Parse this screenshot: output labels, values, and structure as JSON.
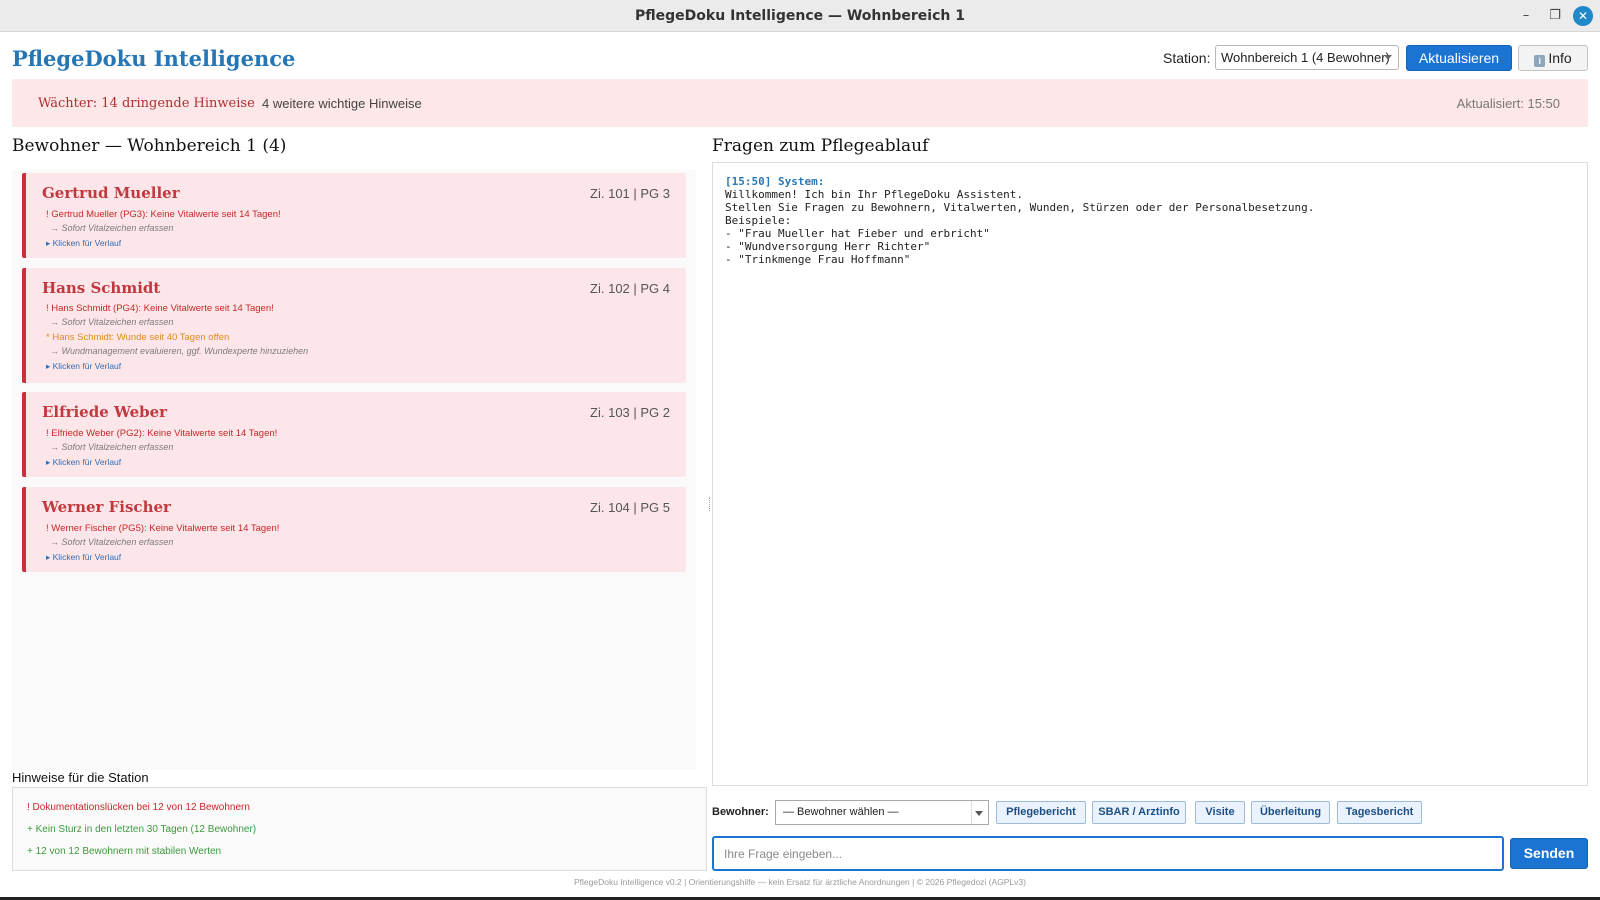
{
  "window": {
    "title": "PflegeDoku Intelligence — Wohnbereich 1",
    "minimize": "–",
    "maximize": "❐",
    "close": "✕"
  },
  "header": {
    "logo": "PflegeDoku Intelligence",
    "station_label": "Station:",
    "station_value": "Wohnbereich 1 (4 Bewohner)",
    "refresh_label": "Aktualisieren",
    "info_label": "Info",
    "info_glyph": "i"
  },
  "alerts": {
    "urgent": "Wächter: 14 dringende Hinweise",
    "more": "4 weitere wichtige Hinweise",
    "updated": "Aktualisiert: 15:50"
  },
  "residents": {
    "title": "Bewohner — Wohnbereich 1 (4)",
    "cards": [
      {
        "name": "Gertrud Mueller",
        "room": "Zi. 101 | PG 3",
        "lines": [
          {
            "type": "crit",
            "text": "! Gertrud Mueller (PG3): Keine Vitalwerte seit 14 Tagen!"
          },
          {
            "type": "hint",
            "text": "→ Sofort Vitalzeichen erfassen"
          },
          {
            "type": "link",
            "text": "▸ Klicken für Verlauf"
          }
        ]
      },
      {
        "name": "Hans Schmidt",
        "room": "Zi. 102 | PG 4",
        "lines": [
          {
            "type": "crit",
            "text": "! Hans Schmidt (PG4): Keine Vitalwerte seit 14 Tagen!"
          },
          {
            "type": "hint",
            "text": "→ Sofort Vitalzeichen erfassen"
          },
          {
            "type": "warn",
            "text": "* Hans Schmidt: Wunde seit 40 Tagen offen"
          },
          {
            "type": "hint",
            "text": "→ Wundmanagement evaluieren, ggf. Wundexperte hinzuziehen"
          },
          {
            "type": "link",
            "text": "▸ Klicken für Verlauf"
          }
        ]
      },
      {
        "name": "Elfriede Weber",
        "room": "Zi. 103 | PG 2",
        "lines": [
          {
            "type": "crit",
            "text": "! Elfriede Weber (PG2): Keine Vitalwerte seit 14 Tagen!"
          },
          {
            "type": "hint",
            "text": "→ Sofort Vitalzeichen erfassen"
          },
          {
            "type": "link",
            "text": "▸ Klicken für Verlauf"
          }
        ]
      },
      {
        "name": "Werner Fischer",
        "room": "Zi. 104 | PG 5",
        "lines": [
          {
            "type": "crit",
            "text": "! Werner Fischer (PG5): Keine Vitalwerte seit 14 Tagen!"
          },
          {
            "type": "hint",
            "text": "→ Sofort Vitalzeichen erfassen"
          },
          {
            "type": "link",
            "text": "▸ Klicken für Verlauf"
          }
        ]
      }
    ]
  },
  "chat": {
    "title": "Fragen zum Pflegeablauf",
    "sender": "[15:50] System:",
    "message": "Willkommen! Ich bin Ihr PflegeDoku Assistent.\nStellen Sie Fragen zu Bewohnern, Vitalwerten, Wunden, Stürzen oder der Personalbesetzung.\nBeispiele:\n- \"Frau Mueller hat Fieber und erbricht\"\n- \"Wundversorgung Herr Richter\"\n- \"Trinkmenge Frau Hoffmann\""
  },
  "station_hints": {
    "title": "Hinweise für die Station",
    "items": [
      {
        "type": "crit",
        "text": "! Dokumentationslücken bei 12 von 12 Bewohnern"
      },
      {
        "type": "ok",
        "text": "+ Kein Sturz in den letzten 30 Tagen (12 Bewohner)"
      },
      {
        "type": "ok",
        "text": "+ 12 von 12 Bewohnern mit stabilen Werten"
      }
    ]
  },
  "toolbar": {
    "resident_label": "Bewohner:",
    "resident_select": "— Bewohner wählen —",
    "buttons": [
      "Pflegebericht",
      "SBAR / Arztinfo",
      "Visite",
      "Überleitung",
      "Tagesbericht"
    ]
  },
  "input": {
    "placeholder": "Ihre Frage eingeben...",
    "send_label": "Senden"
  },
  "footer": "PflegeDoku Intelligence v0.2 | Orientierungshilfe — kein Ersatz für ärztliche Anordnungen | © 2026 Pflegedozi (AGPLv3)",
  "colors": {
    "accent": "#1b74d2",
    "critical": "#c62828",
    "warning": "#e08a1e",
    "ok": "#3d9a3d",
    "card_bg": "#fde6e9"
  }
}
